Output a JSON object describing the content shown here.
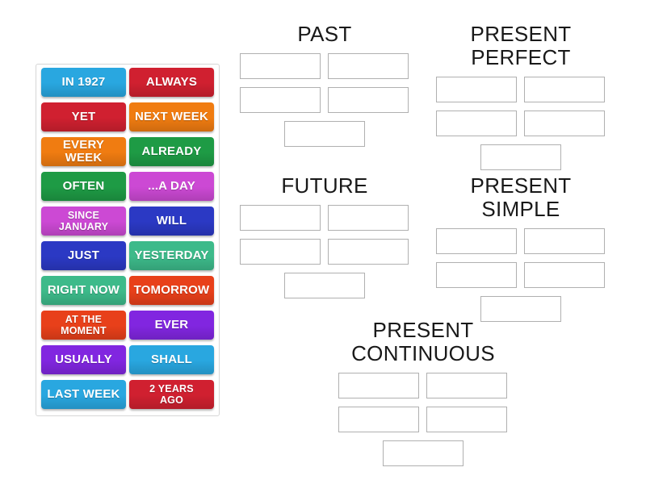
{
  "activity": {
    "type": "group-sort",
    "tile_panel": {
      "name": "word-tile-bank",
      "tiles": [
        {
          "label": "IN 1927",
          "color": "#29a7e0",
          "lines": 1
        },
        {
          "label": "ALWAYS",
          "color": "#d02030",
          "lines": 1
        },
        {
          "label": "YET",
          "color": "#d02030",
          "lines": 1
        },
        {
          "label": "NEXT WEEK",
          "color": "#f07c11",
          "lines": 1
        },
        {
          "label": "EVERY WEEK",
          "color": "#f07c11",
          "lines": 1
        },
        {
          "label": "ALREADY",
          "color": "#1e9b45",
          "lines": 1
        },
        {
          "label": "OFTEN",
          "color": "#1e9b45",
          "lines": 1
        },
        {
          "label": "...A DAY",
          "color": "#cc49d4",
          "lines": 1
        },
        {
          "label": "SINCE\nJANUARY",
          "color": "#cc49d4",
          "lines": 2
        },
        {
          "label": "WILL",
          "color": "#2b39c4",
          "lines": 1
        },
        {
          "label": "JUST",
          "color": "#2b39c4",
          "lines": 1
        },
        {
          "label": "YESTERDAY",
          "color": "#3dba8a",
          "lines": 1
        },
        {
          "label": "RIGHT NOW",
          "color": "#3dba8a",
          "lines": 1
        },
        {
          "label": "TOMORROW",
          "color": "#e8401a",
          "lines": 1
        },
        {
          "label": "AT THE\nMOMENT",
          "color": "#e8401a",
          "lines": 2
        },
        {
          "label": "EVER",
          "color": "#8126e0",
          "lines": 1
        },
        {
          "label": "USUALLY",
          "color": "#8126e0",
          "lines": 1
        },
        {
          "label": "SHALL",
          "color": "#29a7e0",
          "lines": 1
        },
        {
          "label": "LAST WEEK",
          "color": "#29a7e0",
          "lines": 1
        },
        {
          "label": "2 YEARS\nAGO",
          "color": "#d02030",
          "lines": 2
        }
      ]
    },
    "groups": [
      {
        "id": "past",
        "title": "PAST",
        "zones": [
          "",
          "",
          "",
          "",
          ""
        ]
      },
      {
        "id": "present-perfect",
        "title": "PRESENT PERFECT",
        "zones": [
          "",
          "",
          "",
          "",
          ""
        ]
      },
      {
        "id": "future",
        "title": "FUTURE",
        "zones": [
          "",
          "",
          "",
          "",
          ""
        ]
      },
      {
        "id": "present-simple",
        "title": "PRESENT SIMPLE",
        "zones": [
          "",
          "",
          "",
          "",
          ""
        ]
      },
      {
        "id": "present-continuous",
        "title": "PRESENT\nCONTINUOUS",
        "zones": [
          "",
          "",
          "",
          "",
          ""
        ]
      }
    ],
    "colors": {
      "background": "#ffffff",
      "panel_border": "#d6d6d6",
      "zone_border": "#b0b0b0",
      "title_text": "#191919",
      "tile_text": "#ffffff"
    }
  }
}
